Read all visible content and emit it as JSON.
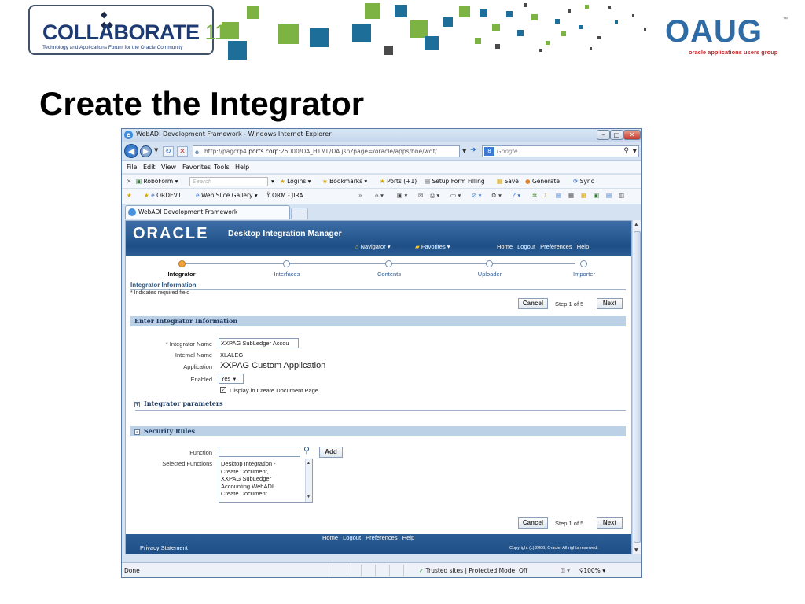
{
  "slide": {
    "title": "Create the Integrator",
    "collaborate_logo": {
      "word": "COLLABORATE",
      "number": "11",
      "tagline": "Technology and Applications Forum for the Oracle Community"
    },
    "oaug_logo": {
      "word": "OAUG",
      "tagline": "oracle applications users group"
    }
  },
  "browser": {
    "window_title": "WebADI Development Framework - Windows Internet Explorer",
    "url_prefix": "http://pagcrp4.",
    "url_host": "ports.corp",
    "url_suffix": ":25000/OA_HTML/OA.jsp?page=/oracle/apps/bne/wdf/",
    "search_placeholder": "Google",
    "menu": [
      "File",
      "Edit",
      "View",
      "Favorites",
      "Tools",
      "Help"
    ],
    "toolbar1": {
      "roboform": "RoboForm",
      "roboform_search": "Search",
      "logins": "Logins",
      "bookmarks": "Bookmarks",
      "ports": "Ports (+1)",
      "setup_form": "Setup Form Filling",
      "save": "Save",
      "generate": "Generate",
      "sync": "Sync"
    },
    "toolbar2": {
      "ordev": "ORDEV1",
      "web_slice": "Web Slice Gallery",
      "orm": "ORM - JIRA"
    },
    "tab_label": "WebADI Development Framework",
    "status": {
      "left": "Done",
      "zone": "Trusted sites | Protected Mode: Off",
      "zoom": "100%"
    }
  },
  "oracle": {
    "logo": "ORACLE",
    "app_title": "Desktop Integration Manager",
    "navigator": "Navigator",
    "favorites": "Favorites",
    "global_links": [
      "Home",
      "Logout",
      "Preferences",
      "Help"
    ],
    "train": [
      "Integrator",
      "Interfaces",
      "Contents",
      "Uploader",
      "Importer"
    ],
    "train_active_index": 0,
    "section_title": "Integrator Information",
    "required_note": "* Indicates required field",
    "cancel_label": "Cancel",
    "step_text": "Step 1 of 5",
    "next_label": "Next",
    "enter_info_header": "Enter Integrator Information",
    "fields": {
      "name_label": "* Integrator Name",
      "name_value": "XXPAG SubLedger Accou",
      "internal_label": "Internal Name",
      "internal_value": "XLALEG",
      "application_label": "Application",
      "application_value": "XXPAG Custom Application",
      "enabled_label": "Enabled",
      "enabled_value": "Yes",
      "display_checkbox_label": "Display in Create Document Page",
      "display_checked": true
    },
    "params_header": "Integrator parameters",
    "security_header": "Security Rules",
    "security": {
      "function_label": "Function",
      "function_value": "",
      "add_label": "Add",
      "selected_label": "Selected Functions",
      "selected_items": [
        "Desktop Integration -",
        "Create Document,",
        "XXPAG SubLedger",
        "Accounting WebADI",
        "Create Document"
      ]
    },
    "footer": {
      "links": [
        "Home",
        "Logout",
        "Preferences",
        "Help"
      ],
      "privacy": "Privacy Statement",
      "copyright": "Copyright (c) 2006, Oracle. All rights reserved."
    }
  }
}
